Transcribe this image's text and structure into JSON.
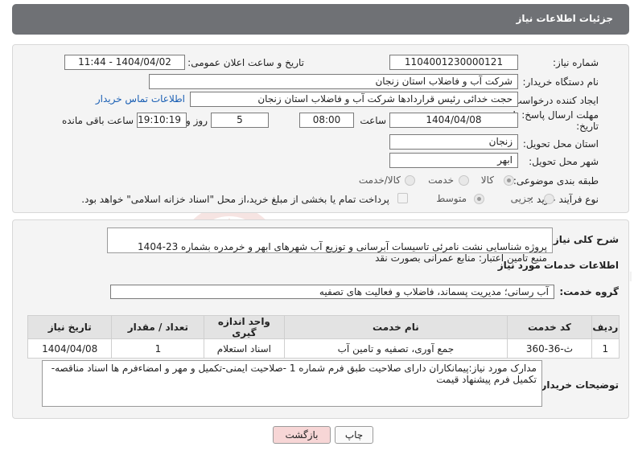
{
  "header": {
    "title": "جزئیات اطلاعات نیاز"
  },
  "form": {
    "need_number_label": "شماره نیاز:",
    "need_number": "1104001230000121",
    "announce_label": "تاریخ و ساعت اعلان عمومی:",
    "announce_value": "1404/04/02 - 11:44",
    "buyer_org_label": "نام دستگاه خریدار:",
    "buyer_org": "شرکت آب و فاضلاب استان زنجان",
    "creator_label": "ایجاد کننده درخواست:",
    "creator": "حجت  خدائی رئیس قراردادها شرکت آب و فاضلاب استان زنجان",
    "contact_link": "اطلاعات تماس خریدار",
    "deadline_label_1": "مهلت ارسال پاسخ: تا",
    "deadline_label_2": "تاریخ:",
    "deadline_date": "1404/04/08",
    "time_label": "ساعت",
    "deadline_time": "08:00",
    "days_value": "5",
    "days_label": "روز و",
    "remaining_time": "19:10:19",
    "remaining_label": "ساعت باقی مانده",
    "province_label": "استان محل تحویل:",
    "province": "زنجان",
    "city_label": "شهر محل تحویل:",
    "city": "ابهر",
    "category_label": "طبقه بندی موضوعی:",
    "category_options": [
      "کالا",
      "خدمت",
      "کالا/خدمت"
    ],
    "process_label": "نوع فرآیند خرید :",
    "process_options": [
      "جزیی",
      "متوسط"
    ],
    "payment_note": "پرداخت تمام یا بخشی از مبلغ خرید،از محل \"اسناد خزانه اسلامی\" خواهد بود."
  },
  "summary": {
    "label": "شرح کلی نیاز:",
    "text": "پروژه شناسایی نشت نامرئی تاسیسات آبرسانی و توزیع آب شهرهای ابهر و خرمدره بشماره 23-1404\nمنبع تامین اعتبار: منابع عمرانی بصورت نقد"
  },
  "services": {
    "section_title": "اطلاعات خدمات مورد نیاز",
    "group_label": "گروه خدمت:",
    "group_value": "آب رسانی؛ مدیریت پسماند، فاضلاب و فعالیت های تصفیه",
    "columns": [
      "ردیف",
      "کد خدمت",
      "نام خدمت",
      "واحد اندازه گیری",
      "تعداد / مقدار",
      "تاریخ نیاز"
    ],
    "rows": [
      [
        "1",
        "ث-36-360",
        "جمع آوری، تصفیه و تامین آب",
        "اسناد استعلام",
        "1",
        "1404/04/08"
      ]
    ]
  },
  "notes": {
    "label": "توضیحات خریدار:",
    "text": "مدارک مورد نیاز:پیمانکاران دارای صلاحیت طبق فرم شماره 1 -صلاحیت ایمنی-تکمیل و مهر و امضاءفرم ها اسناد مناقصه-تکمیل فرم پیشنهاد قیمت"
  },
  "buttons": {
    "print": "چاپ",
    "back": "بازگشت"
  },
  "colors": {
    "header_bg": "#6f7175",
    "link": "#1a5fb4",
    "back_btn": "#f7d6d6"
  }
}
